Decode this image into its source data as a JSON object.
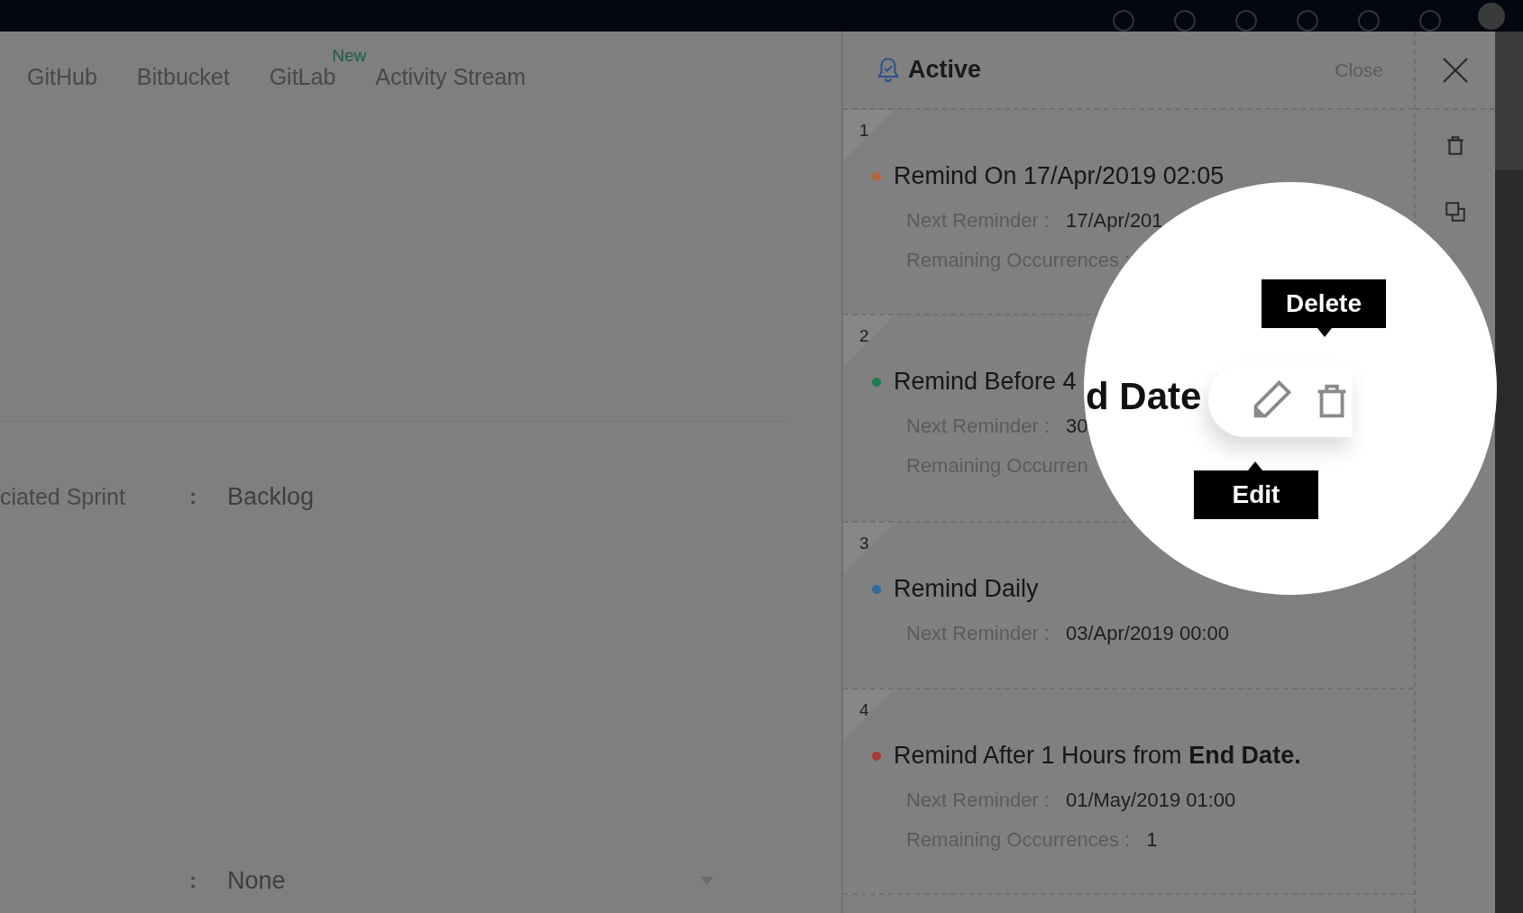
{
  "tabs": [
    {
      "label": "GitHub",
      "selected": false
    },
    {
      "label": "Bitbucket",
      "selected": false
    },
    {
      "label": "GitLab",
      "selected": false,
      "badge": "New"
    },
    {
      "label": "Activity Stream",
      "selected": false
    }
  ],
  "sprint_field": {
    "label": "ciated Sprint",
    "separator": ":",
    "value": "Backlog"
  },
  "dropdown": {
    "separator": ":",
    "value": "None"
  },
  "panel": {
    "title": "Active",
    "close": "Close"
  },
  "reminders": [
    {
      "number": "1",
      "title": "Remind On 17/Apr/2019 02:05",
      "color": "#b0673a",
      "details": [
        {
          "label": "Next Reminder :",
          "value": "17/Apr/201"
        },
        {
          "label": "Remaining Occurrences :"
        }
      ]
    },
    {
      "number": "2",
      "title": "Remind Before 4",
      "color": "#1e7a4e",
      "details": [
        {
          "label": "Next Reminder :",
          "value": "30"
        },
        {
          "label": "Remaining Occurren"
        }
      ]
    },
    {
      "number": "3",
      "title": "Remind Daily",
      "color": "#2f6a9a",
      "details": [
        {
          "label": "Next Reminder :",
          "value": "03/Apr/2019 00:00"
        }
      ]
    },
    {
      "number": "4",
      "title": "Remind After 1 Hours from **End Date.**",
      "color": "#a83a3a",
      "details": [
        {
          "label": "Next Reminder :",
          "value": "01/May/2019 01:00"
        },
        {
          "label": "Remaining Occurrences :",
          "value": "1"
        }
      ]
    }
  ],
  "lens": {
    "text": "d Date",
    "delete_tooltip": "Delete",
    "edit_tooltip": "Edit"
  }
}
